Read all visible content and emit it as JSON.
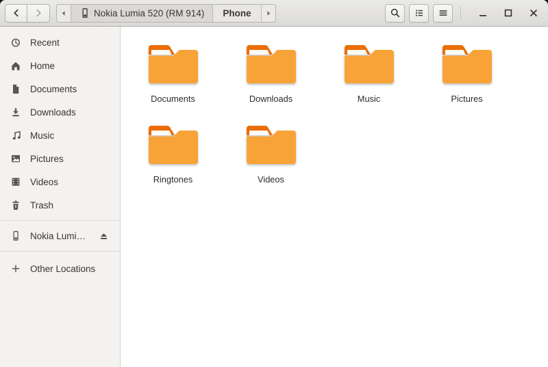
{
  "header": {
    "nav_buttons": [
      {
        "name": "back",
        "icon": "chevron-left",
        "enabled": true
      },
      {
        "name": "forward",
        "icon": "chevron-right",
        "enabled": false
      }
    ],
    "breadcrumb": {
      "scroll_left_icon": "triangle-left",
      "scroll_right_icon": "triangle-right",
      "segments": [
        {
          "label": "Nokia Lumia 520 (RM 914)",
          "icon": "phone",
          "current": false
        },
        {
          "label": "Phone",
          "current": true
        }
      ]
    },
    "action_buttons": [
      {
        "name": "search",
        "icon": "search"
      },
      {
        "name": "view-list",
        "icon": "list"
      },
      {
        "name": "menu",
        "icon": "menu"
      }
    ],
    "window_controls": [
      {
        "name": "minimize",
        "icon": "minimize"
      },
      {
        "name": "maximize",
        "icon": "maximize"
      },
      {
        "name": "close",
        "icon": "close"
      }
    ]
  },
  "sidebar": {
    "items": [
      {
        "label": "Recent",
        "icon": "clock"
      },
      {
        "label": "Home",
        "icon": "home"
      },
      {
        "label": "Documents",
        "icon": "document"
      },
      {
        "label": "Downloads",
        "icon": "download"
      },
      {
        "label": "Music",
        "icon": "music-note"
      },
      {
        "label": "Pictures",
        "icon": "image"
      },
      {
        "label": "Videos",
        "icon": "film"
      },
      {
        "label": "Trash",
        "icon": "trash"
      }
    ],
    "device": {
      "label": "Nokia Lumi…",
      "icon": "phone",
      "eject_icon": "eject"
    },
    "other_locations": {
      "label": "Other Locations",
      "icon": "plus"
    }
  },
  "content": {
    "folder_icon": "folder",
    "folders": [
      {
        "name": "Documents"
      },
      {
        "name": "Downloads"
      },
      {
        "name": "Music"
      },
      {
        "name": "Pictures"
      },
      {
        "name": "Ringtones"
      },
      {
        "name": "Videos"
      }
    ]
  },
  "colors": {
    "folder_body": "#f8a338",
    "folder_tab": "#ec6d01",
    "folder_strip": "#fcfbf8",
    "header_text": "#3a3834"
  }
}
